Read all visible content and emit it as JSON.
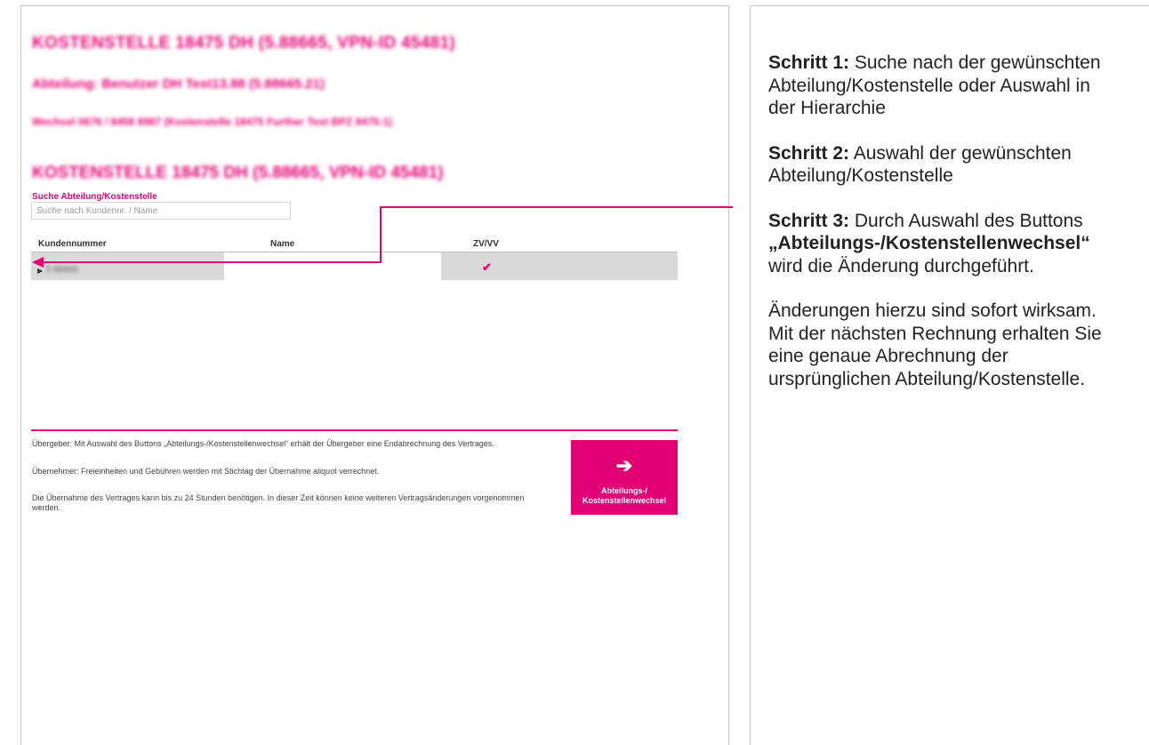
{
  "left": {
    "title_main": "KOSTENSTELLE 18475 DH (5.88665, VPN-ID 45481)",
    "department": "Abteilung: Benutzer DH Test13.88 (5.88665.21)",
    "change": "Wechsel 0676 / 8458 8987 (Kostenstelle 18475 Further Test BPZ 8475-1)",
    "title_sub": "KOSTENSTELLE 18475 DH (5.88665, VPN-ID 45481)",
    "search": {
      "label": "Suche Abteilung/Kostenstelle",
      "placeholder": "Suche nach Kundennr. / Name"
    },
    "table": {
      "headers": [
        "Kundennummer",
        "Name",
        "ZV/VV"
      ],
      "rows": [
        {
          "kundennummer": "5.88665",
          "name": "",
          "zv": "✔"
        }
      ]
    },
    "notes": [
      "Übergeber: Mit Auswahl des Buttons „Abteilungs-/Kostenstellenwechsel“ erhält der Übergeber eine Endabrechnung des Vertrages.",
      "Übernehmer: Freieinheiten und Gebühren werden mit Stichtag der Übernahme aliquot verrechnet.",
      "Die Übernahme des Vertrages kann bis zu 24 Stunden benötigen. In dieser Zeit können keine weiteren Vertragsänderungen vorgenommen werden."
    ],
    "button": {
      "icon": "arrow-right-icon",
      "label": "Abteilungs-/ Kostenstellenwechsel"
    }
  },
  "steps": [
    {
      "label": "Schritt 1:",
      "text": " Suche nach der gewünschten Abteilung/Kostenstelle oder Auswahl in der Hierarchie"
    },
    {
      "label": "Schritt 2:",
      "text": " Auswahl der gewünschten Abteilung/Kostenstelle"
    },
    {
      "label": "Schritt 3:",
      "text_before": " Durch Auswahl des Buttons ",
      "button_name": "„Abteilungs-/Kostenstellenwechsel“",
      "text_after": " wird die Änderung durchgeführt."
    },
    {
      "text": "Änderungen hierzu sind sofort wirksam. Mit der nächsten Rechnung erhalten Sie eine genaue Abrechnung der ursprünglichen Abteilung/Kostenstelle."
    }
  ],
  "colors": {
    "accent": "#e20074",
    "row_bg": "#d9d9d9"
  }
}
